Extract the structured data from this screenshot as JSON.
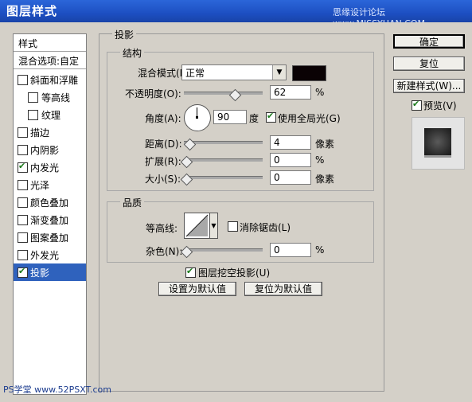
{
  "window": {
    "title": "图层样式",
    "watermark": "思缘设计论坛 www.MISSYUAN.COM",
    "footer_logo": "PS学堂 www.52PSXT.com"
  },
  "styles_list": {
    "header": "样式",
    "blend_options": "混合选项:自定",
    "items": [
      {
        "label": "斜面和浮雕",
        "checked": false,
        "indent": false
      },
      {
        "label": "等高线",
        "checked": false,
        "indent": true
      },
      {
        "label": "纹理",
        "checked": false,
        "indent": true
      },
      {
        "label": "描边",
        "checked": false,
        "indent": false
      },
      {
        "label": "内阴影",
        "checked": false,
        "indent": false
      },
      {
        "label": "内发光",
        "checked": true,
        "indent": false
      },
      {
        "label": "光泽",
        "checked": false,
        "indent": false
      },
      {
        "label": "颜色叠加",
        "checked": false,
        "indent": false
      },
      {
        "label": "渐变叠加",
        "checked": false,
        "indent": false
      },
      {
        "label": "图案叠加",
        "checked": false,
        "indent": false
      },
      {
        "label": "外发光",
        "checked": false,
        "indent": false
      },
      {
        "label": "投影",
        "checked": true,
        "indent": false,
        "selected": true
      }
    ]
  },
  "drop_shadow": {
    "title": "投影",
    "structure": {
      "title": "结构",
      "blend_mode_label": "混合模式(B):",
      "blend_mode": "正常",
      "color": "#0a0204",
      "opacity_label": "不透明度(O):",
      "opacity": "62",
      "opacity_unit": "%",
      "angle_label": "角度(A):",
      "angle": "90",
      "angle_unit": "度",
      "global_light_label": "使用全局光(G)",
      "global_light": true,
      "distance_label": "距离(D):",
      "distance": "4",
      "distance_unit": "像素",
      "spread_label": "扩展(R):",
      "spread": "0",
      "spread_unit": "%",
      "size_label": "大小(S):",
      "size": "0",
      "size_unit": "像素"
    },
    "quality": {
      "title": "品质",
      "contour_label": "等高线:",
      "anti_alias_label": "消除锯齿(L)",
      "anti_alias": false,
      "noise_label": "杂色(N):",
      "noise": "0",
      "noise_unit": "%"
    },
    "knockout_label": "图层挖空投影(U)",
    "knockout": true,
    "set_default": "设置为默认值",
    "reset_default": "复位为默认值"
  },
  "right": {
    "ok": "确定",
    "reset": "复位",
    "new_style": "新建样式(W)...",
    "preview_label": "预览(V)",
    "preview": true
  }
}
